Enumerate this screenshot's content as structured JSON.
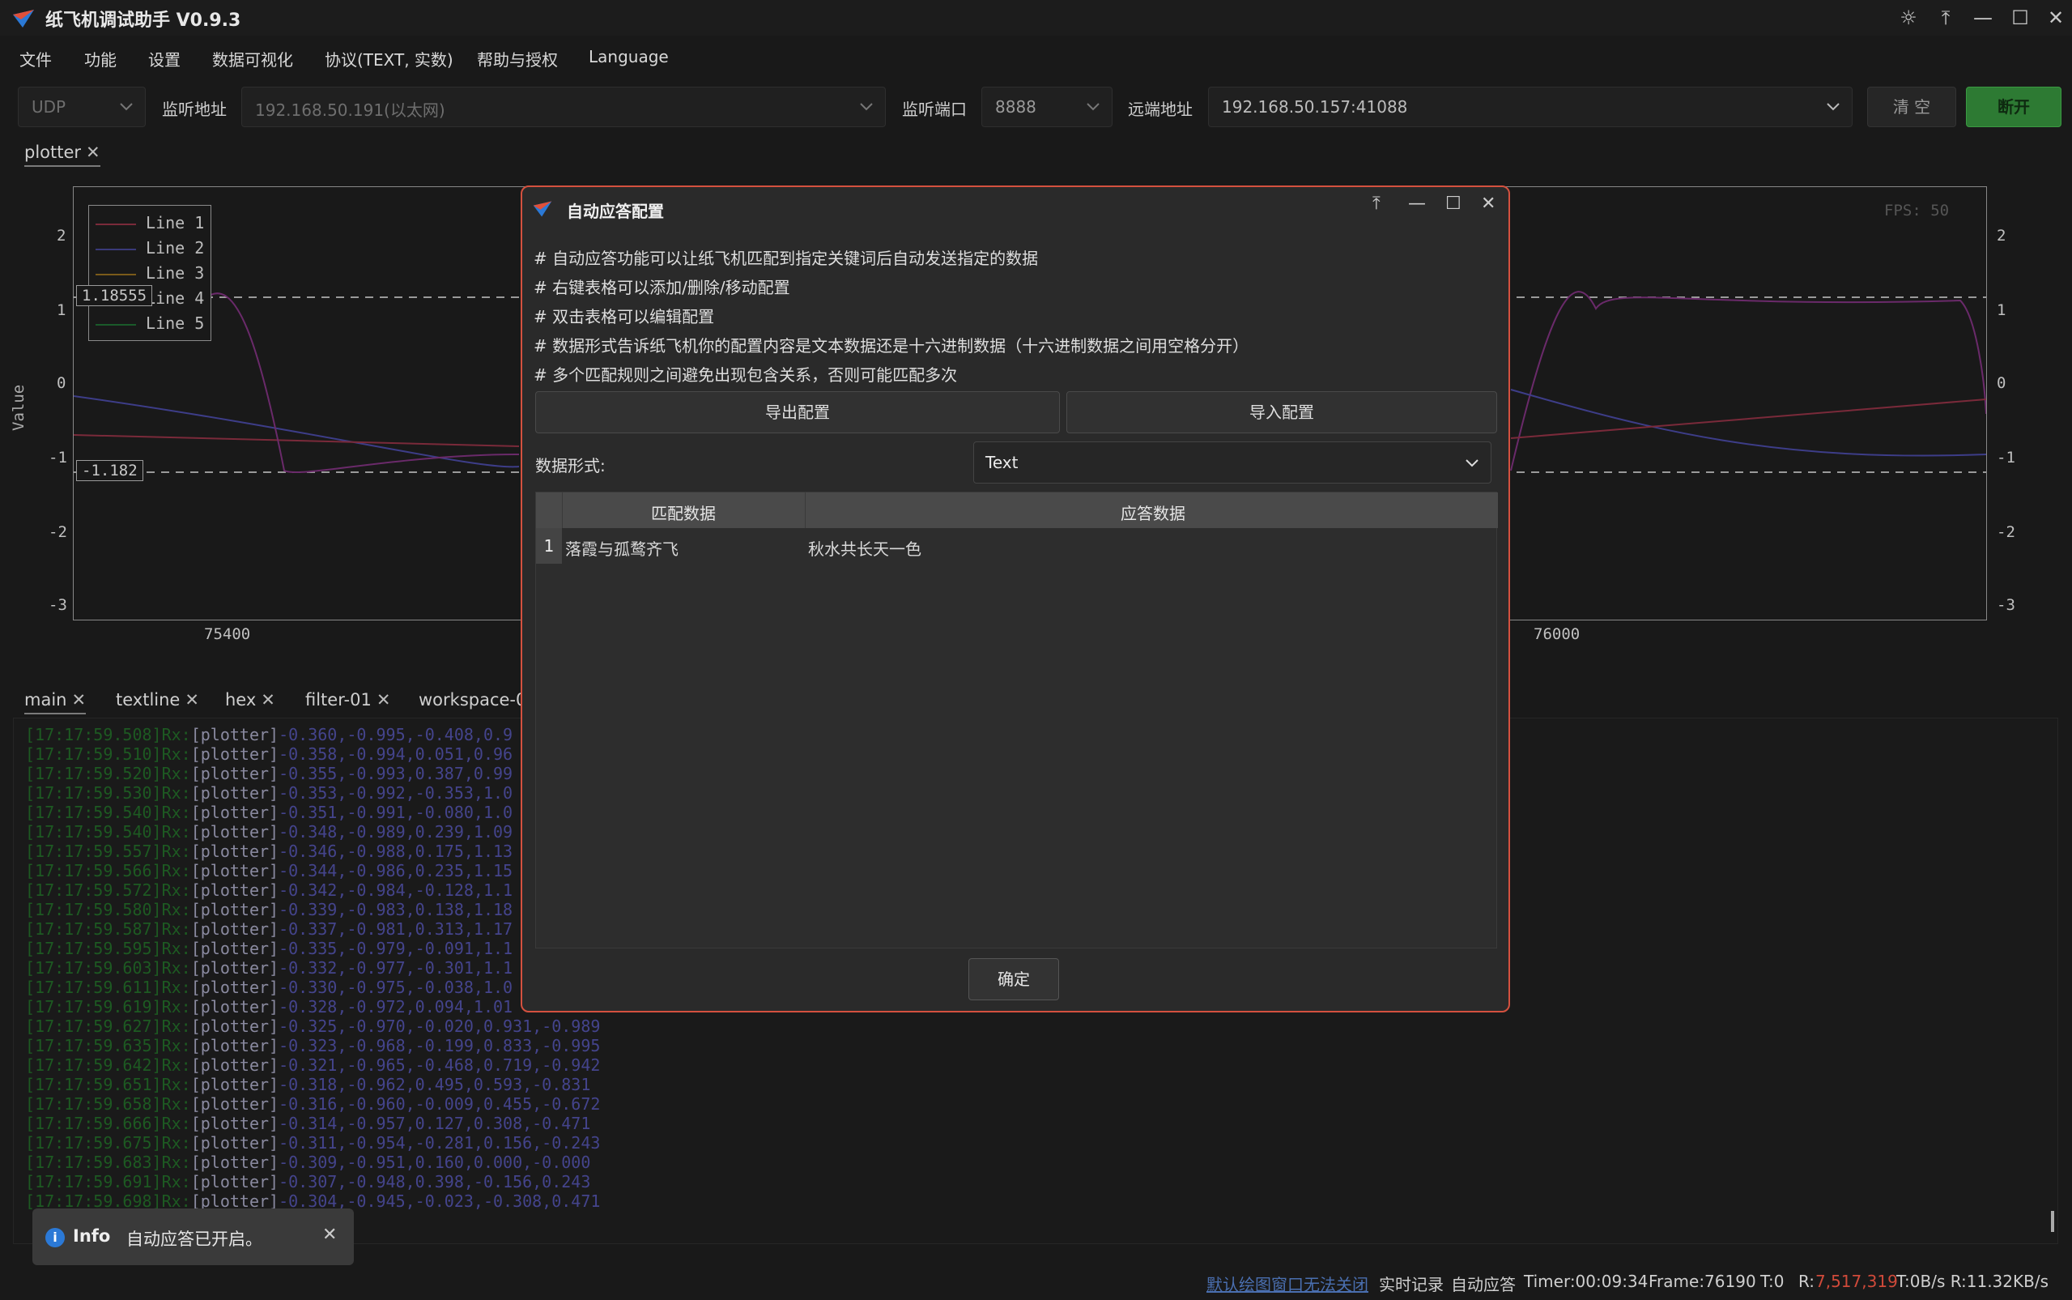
{
  "app": {
    "title": "纸飞机调试助手 V0.9.3",
    "window_buttons": [
      "theme-icon",
      "pin-icon",
      "minimize-icon",
      "maximize-icon",
      "close-icon"
    ]
  },
  "menu": [
    "文件",
    "功能",
    "设置",
    "数据可视化",
    "协议(TEXT, 实数)",
    "帮助与授权",
    "Language"
  ],
  "toolbar": {
    "protocol": "UDP",
    "listen_label": "监听地址",
    "listen_address": "192.168.50.191(以太网)",
    "port_label": "监听端口",
    "port": "8888",
    "remote_label": "远端地址",
    "remote_address": "192.168.50.157:41088",
    "clear_label": "清 空",
    "disconnect_label": "断开"
  },
  "plot_tab": "plotter",
  "plot": {
    "fps": "FPS: 50",
    "ylabel": "Value",
    "y_ticks": [
      "2",
      "1",
      "0",
      "-1",
      "-2",
      "-3"
    ],
    "x_ticks": [
      "75400",
      "76000"
    ],
    "legend": [
      "Line 1",
      "Line 2",
      "Line 3",
      "Line 4",
      "Line 5"
    ],
    "marker_upper": "1.18555",
    "marker_lower": "-1.182",
    "colors": [
      "#7a2a3a",
      "#3a3a7a",
      "#7a5a1a",
      "#6a2a6a",
      "#1a5a2a"
    ]
  },
  "console_tabs": [
    "main",
    "textline",
    "hex",
    "filter-01",
    "workspace-01"
  ],
  "console": [
    {
      "ts": "[17:17:59.508]Rx:",
      "tag": "[plotter]",
      "data": "-0.360,-0.995,-0.408,0.9"
    },
    {
      "ts": "[17:17:59.510]Rx:",
      "tag": "[plotter]",
      "data": "-0.358,-0.994,0.051,0.96"
    },
    {
      "ts": "[17:17:59.520]Rx:",
      "tag": "[plotter]",
      "data": "-0.355,-0.993,0.387,0.99"
    },
    {
      "ts": "[17:17:59.530]Rx:",
      "tag": "[plotter]",
      "data": "-0.353,-0.992,-0.353,1.0"
    },
    {
      "ts": "[17:17:59.540]Rx:",
      "tag": "[plotter]",
      "data": "-0.351,-0.991,-0.080,1.0"
    },
    {
      "ts": "[17:17:59.540]Rx:",
      "tag": "[plotter]",
      "data": "-0.348,-0.989,0.239,1.09"
    },
    {
      "ts": "[17:17:59.557]Rx:",
      "tag": "[plotter]",
      "data": "-0.346,-0.988,0.175,1.13"
    },
    {
      "ts": "[17:17:59.566]Rx:",
      "tag": "[plotter]",
      "data": "-0.344,-0.986,0.235,1.15"
    },
    {
      "ts": "[17:17:59.572]Rx:",
      "tag": "[plotter]",
      "data": "-0.342,-0.984,-0.128,1.1"
    },
    {
      "ts": "[17:17:59.580]Rx:",
      "tag": "[plotter]",
      "data": "-0.339,-0.983,0.138,1.18"
    },
    {
      "ts": "[17:17:59.587]Rx:",
      "tag": "[plotter]",
      "data": "-0.337,-0.981,0.313,1.17"
    },
    {
      "ts": "[17:17:59.595]Rx:",
      "tag": "[plotter]",
      "data": "-0.335,-0.979,-0.091,1.1"
    },
    {
      "ts": "[17:17:59.603]Rx:",
      "tag": "[plotter]",
      "data": "-0.332,-0.977,-0.301,1.1"
    },
    {
      "ts": "[17:17:59.611]Rx:",
      "tag": "[plotter]",
      "data": "-0.330,-0.975,-0.038,1.0"
    },
    {
      "ts": "[17:17:59.619]Rx:",
      "tag": "[plotter]",
      "data": "-0.328,-0.972,0.094,1.01"
    },
    {
      "ts": "[17:17:59.627]Rx:",
      "tag": "[plotter]",
      "data": "-0.325,-0.970,-0.020,0.931,-0.989"
    },
    {
      "ts": "[17:17:59.635]Rx:",
      "tag": "[plotter]",
      "data": "-0.323,-0.968,-0.199,0.833,-0.995"
    },
    {
      "ts": "[17:17:59.642]Rx:",
      "tag": "[plotter]",
      "data": "-0.321,-0.965,-0.468,0.719,-0.942"
    },
    {
      "ts": "[17:17:59.651]Rx:",
      "tag": "[plotter]",
      "data": "-0.318,-0.962,0.495,0.593,-0.831"
    },
    {
      "ts": "[17:17:59.658]Rx:",
      "tag": "[plotter]",
      "data": "-0.316,-0.960,-0.009,0.455,-0.672"
    },
    {
      "ts": "[17:17:59.666]Rx:",
      "tag": "[plotter]",
      "data": "-0.314,-0.957,0.127,0.308,-0.471"
    },
    {
      "ts": "[17:17:59.675]Rx:",
      "tag": "[plotter]",
      "data": "-0.311,-0.954,-0.281,0.156,-0.243"
    },
    {
      "ts": "[17:17:59.683]Rx:",
      "tag": "[plotter]",
      "data": "-0.309,-0.951,0.160,0.000,-0.000"
    },
    {
      "ts": "[17:17:59.691]Rx:",
      "tag": "[plotter]",
      "data": "-0.307,-0.948,0.398,-0.156,0.243"
    },
    {
      "ts": "[17:17:59.698]Rx:",
      "tag": "[plotter]",
      "data": "-0.304,-0.945,-0.023,-0.308,0.471"
    }
  ],
  "toast": {
    "title": "Info",
    "message": "自动应答已开启。"
  },
  "status": {
    "link": "默认绘图窗口无法关闭",
    "record": "实时记录",
    "auto_reply": "自动应答",
    "timer": "Timer:00:09:34",
    "frame": "Frame:76190",
    "tx": "T:0",
    "r_label": "R:",
    "r_value": "7,517,319",
    "rates": "T:0B/s R:11.32KB/s"
  },
  "dialog": {
    "title": "自动应答配置",
    "notes": [
      "# 自动应答功能可以让纸飞机匹配到指定关键词后自动发送指定的数据",
      "# 右键表格可以添加/删除/移动配置",
      "# 双击表格可以编辑配置",
      "# 数据形式告诉纸飞机你的配置内容是文本数据还是十六进制数据（十六进制数据之间用空格分开）",
      "# 多个匹配规则之间避免出现包含关系，否则可能匹配多次"
    ],
    "export_label": "导出配置",
    "import_label": "导入配置",
    "format_label": "数据形式:",
    "format_value": "Text",
    "col_match": "匹配数据",
    "col_reply": "应答数据",
    "rows": [
      {
        "index": "1",
        "match": "落霞与孤鹜齐飞",
        "reply": "秋水共长天一色"
      }
    ],
    "ok_label": "确定"
  }
}
